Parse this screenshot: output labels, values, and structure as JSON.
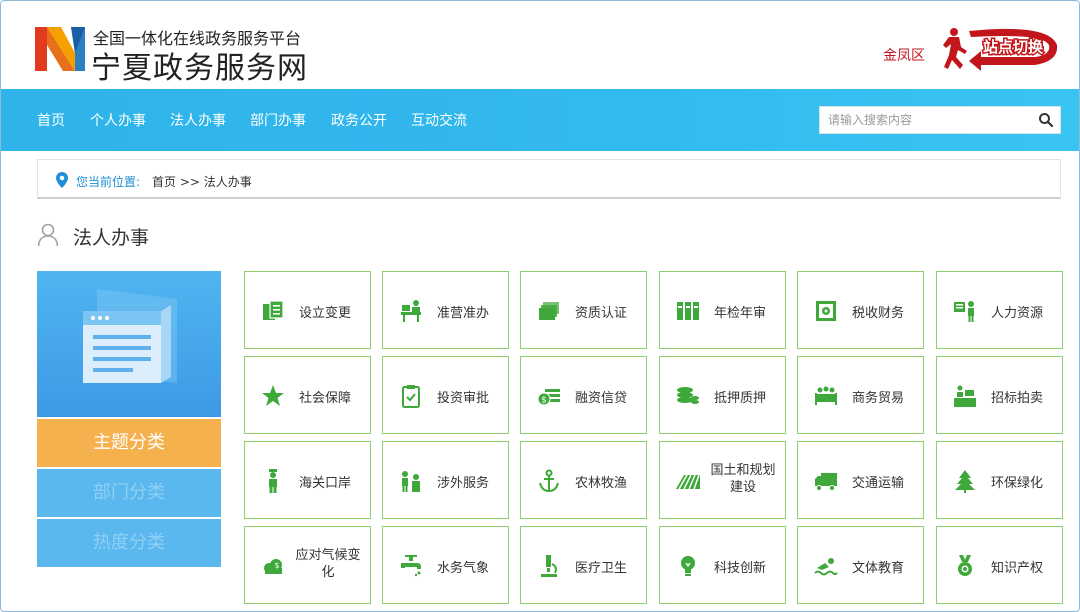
{
  "header": {
    "platform_subtitle": "全国一体化在线政务服务平台",
    "site_title": "宁夏政务服务网",
    "region": "金凤区",
    "switch_label": "站点切换"
  },
  "nav": {
    "items": [
      "首页",
      "个人办事",
      "法人办事",
      "部门办事",
      "政务公开",
      "互动交流"
    ],
    "search_placeholder": "请输入搜索内容"
  },
  "breadcrumb": {
    "label": "您当前位置:",
    "path": "首页 >> 法人办事"
  },
  "section": {
    "title": "法人办事"
  },
  "side_tabs": [
    "主题分类",
    "部门分类",
    "热度分类"
  ],
  "grid": [
    {
      "label": "设立变更",
      "icon": "documents-icon"
    },
    {
      "label": "准营准办",
      "icon": "desk-person-icon"
    },
    {
      "label": "资质认证",
      "icon": "cards-icon"
    },
    {
      "label": "年检年审",
      "icon": "binders-icon"
    },
    {
      "label": "税收财务",
      "icon": "safe-icon"
    },
    {
      "label": "人力资源",
      "icon": "person-board-icon"
    },
    {
      "label": "社会保障",
      "icon": "star-icon"
    },
    {
      "label": "投资审批",
      "icon": "clipboard-check-icon"
    },
    {
      "label": "融资信贷",
      "icon": "money-icon"
    },
    {
      "label": "抵押质押",
      "icon": "coins-icon"
    },
    {
      "label": "商务贸易",
      "icon": "meeting-icon"
    },
    {
      "label": "招标拍卖",
      "icon": "podium-icon"
    },
    {
      "label": "海关口岸",
      "icon": "officer-icon"
    },
    {
      "label": "涉外服务",
      "icon": "people-icon"
    },
    {
      "label": "农林牧渔",
      "icon": "anchor-icon"
    },
    {
      "label": "国土和规划建设",
      "icon": "field-icon"
    },
    {
      "label": "交通运输",
      "icon": "truck-icon"
    },
    {
      "label": "环保绿化",
      "icon": "tree-icon"
    },
    {
      "label": "应对气候变化",
      "icon": "cloud-icon"
    },
    {
      "label": "水务气象",
      "icon": "faucet-icon"
    },
    {
      "label": "医疗卫生",
      "icon": "microscope-icon"
    },
    {
      "label": "科技创新",
      "icon": "lightbulb-icon"
    },
    {
      "label": "文体教育",
      "icon": "swimmer-icon"
    },
    {
      "label": "知识产权",
      "icon": "medal-icon"
    }
  ],
  "colors": {
    "nav_bg": "#31b7ec",
    "accent_red": "#c3161c",
    "tab_active": "#f6b14f",
    "tab_inactive": "#5ab8ef",
    "icon_green": "#3fa83a",
    "cell_border": "#8ed06b",
    "crumb_blue": "#1e8fd6"
  }
}
